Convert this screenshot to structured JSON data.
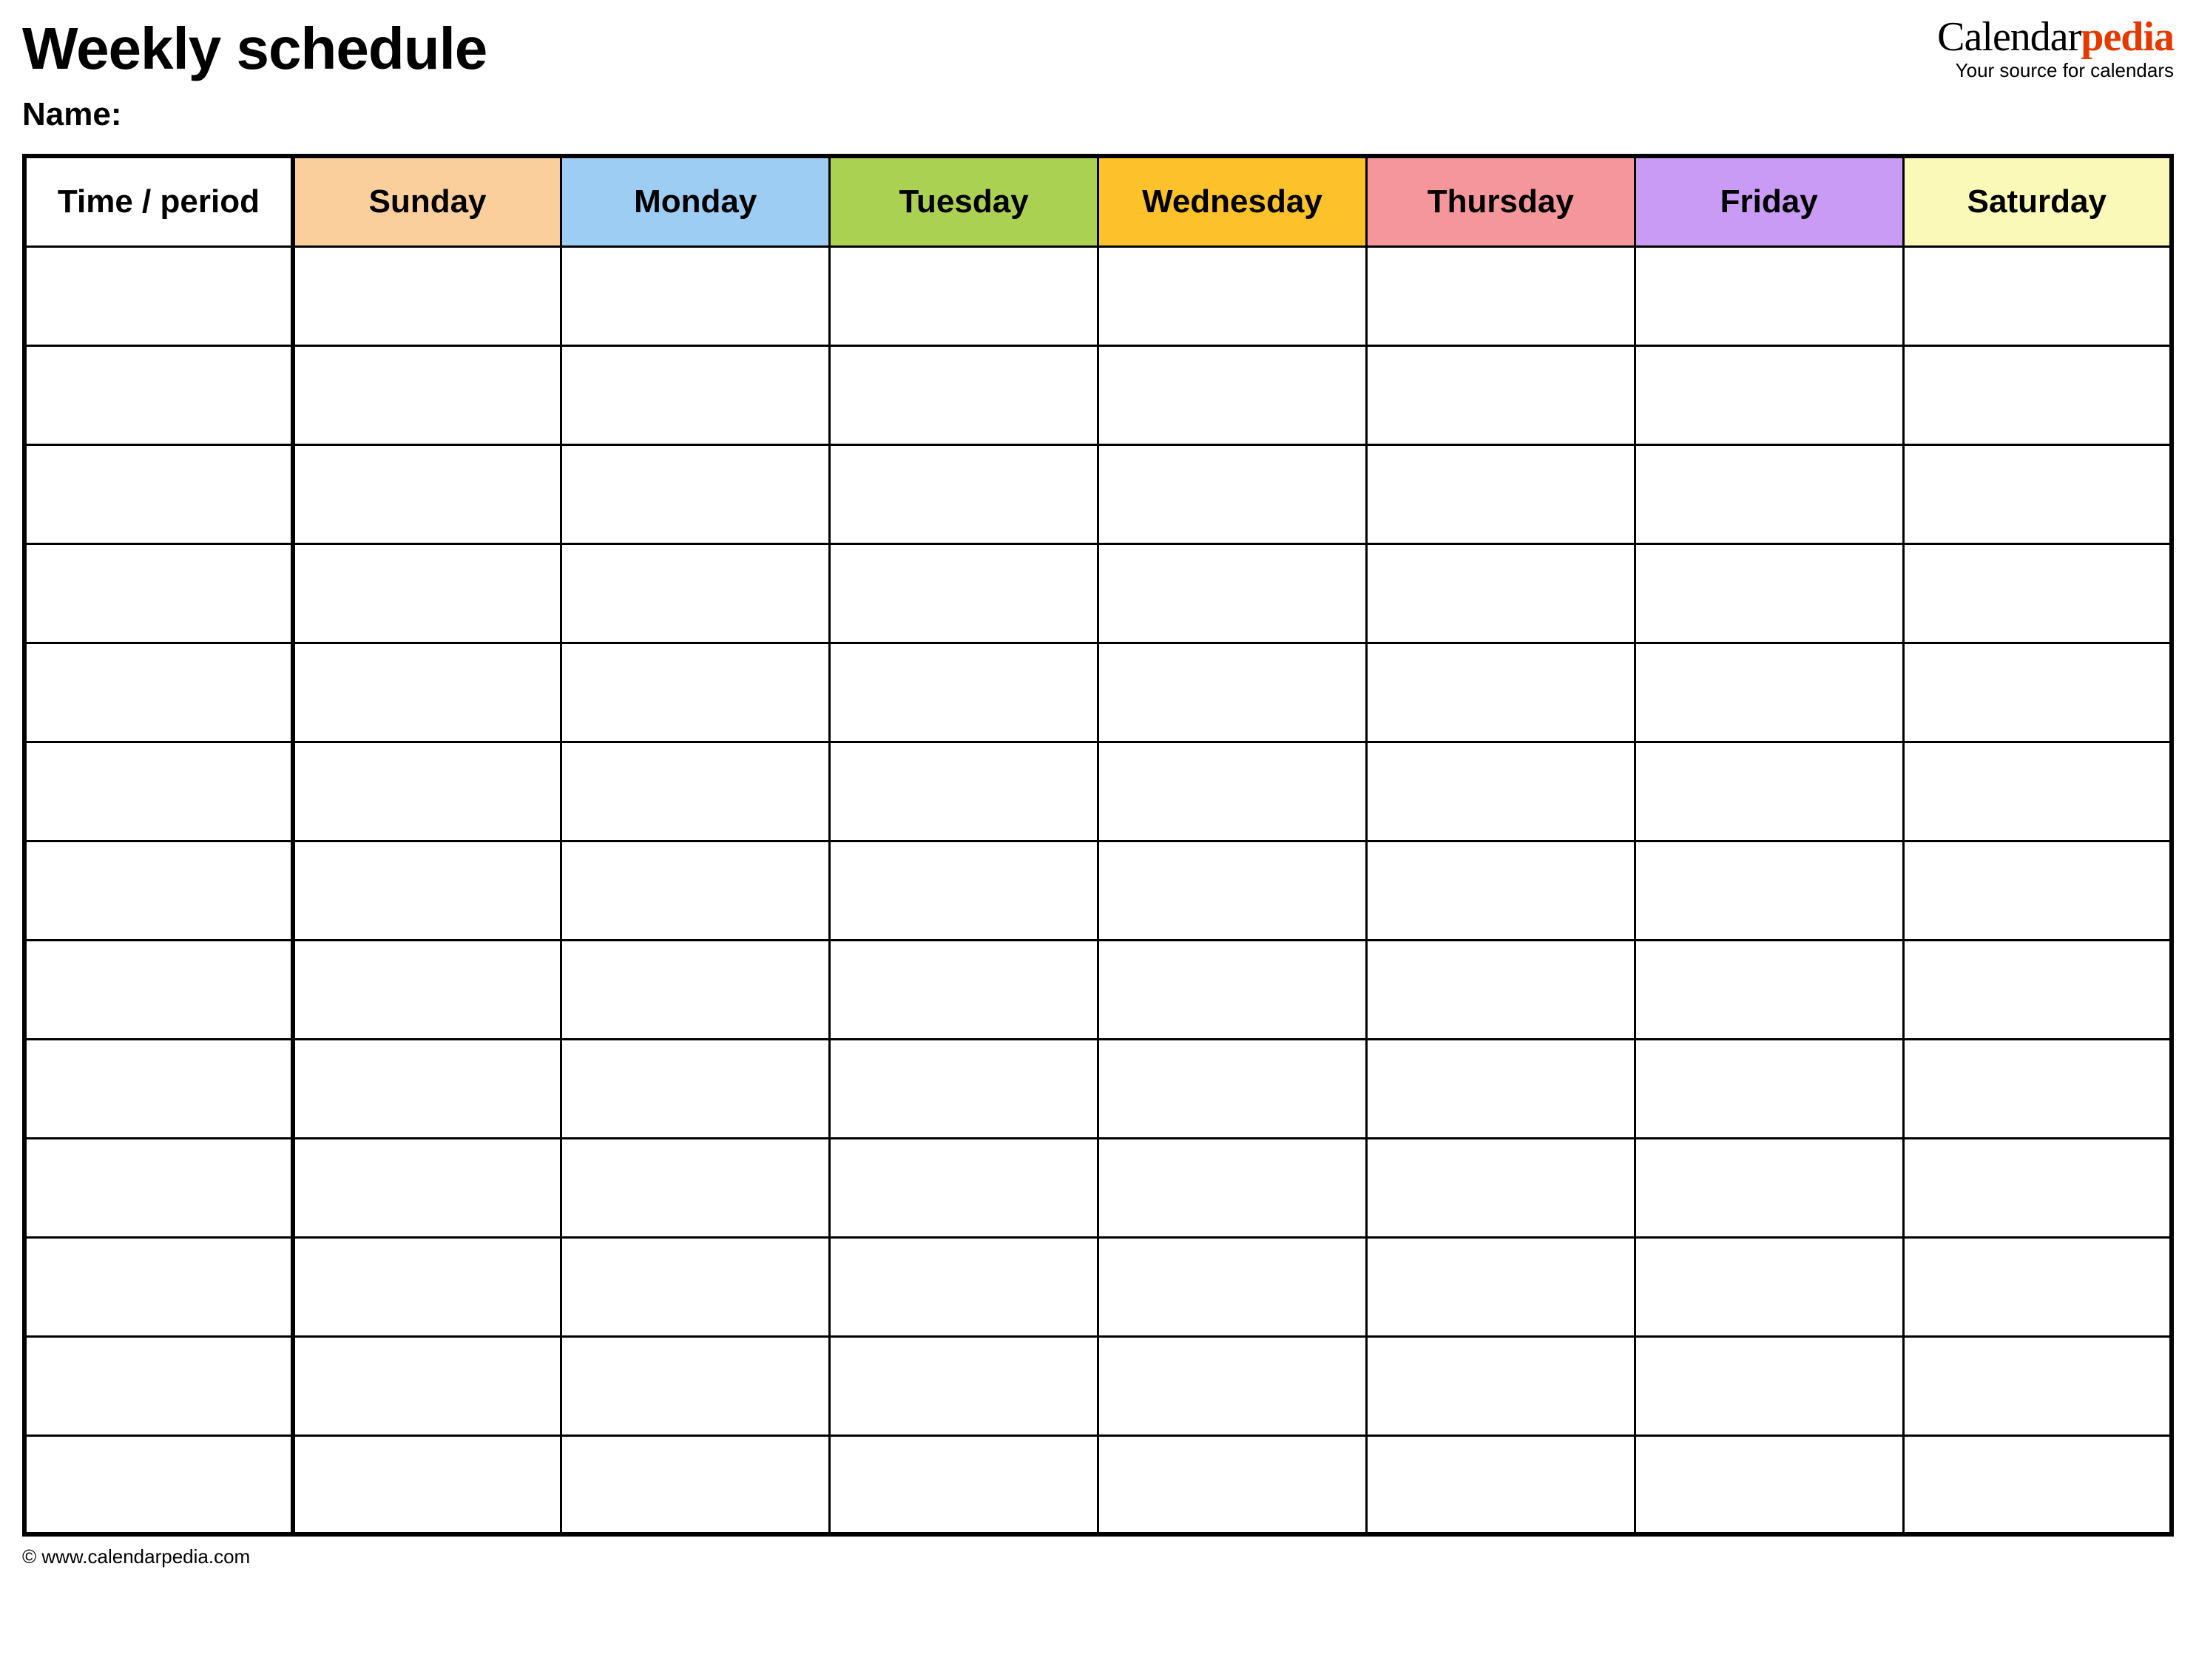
{
  "header": {
    "title": "Weekly schedule",
    "name_label": "Name:"
  },
  "brand": {
    "part1": "Calendar",
    "part2": "pedia",
    "tagline": "Your source for calendars"
  },
  "columns": [
    {
      "label": "Time / period",
      "bg": "#ffffff"
    },
    {
      "label": "Sunday",
      "bg": "#fbcf9c"
    },
    {
      "label": "Monday",
      "bg": "#9ecdf4"
    },
    {
      "label": "Tuesday",
      "bg": "#aad151"
    },
    {
      "label": "Wednesday",
      "bg": "#fdc22a"
    },
    {
      "label": "Thursday",
      "bg": "#f5979a"
    },
    {
      "label": "Friday",
      "bg": "#c99bf4"
    },
    {
      "label": "Saturday",
      "bg": "#fbf9b8"
    }
  ],
  "row_count": 13,
  "footer": {
    "copyright": "© www.calendarpedia.com"
  }
}
